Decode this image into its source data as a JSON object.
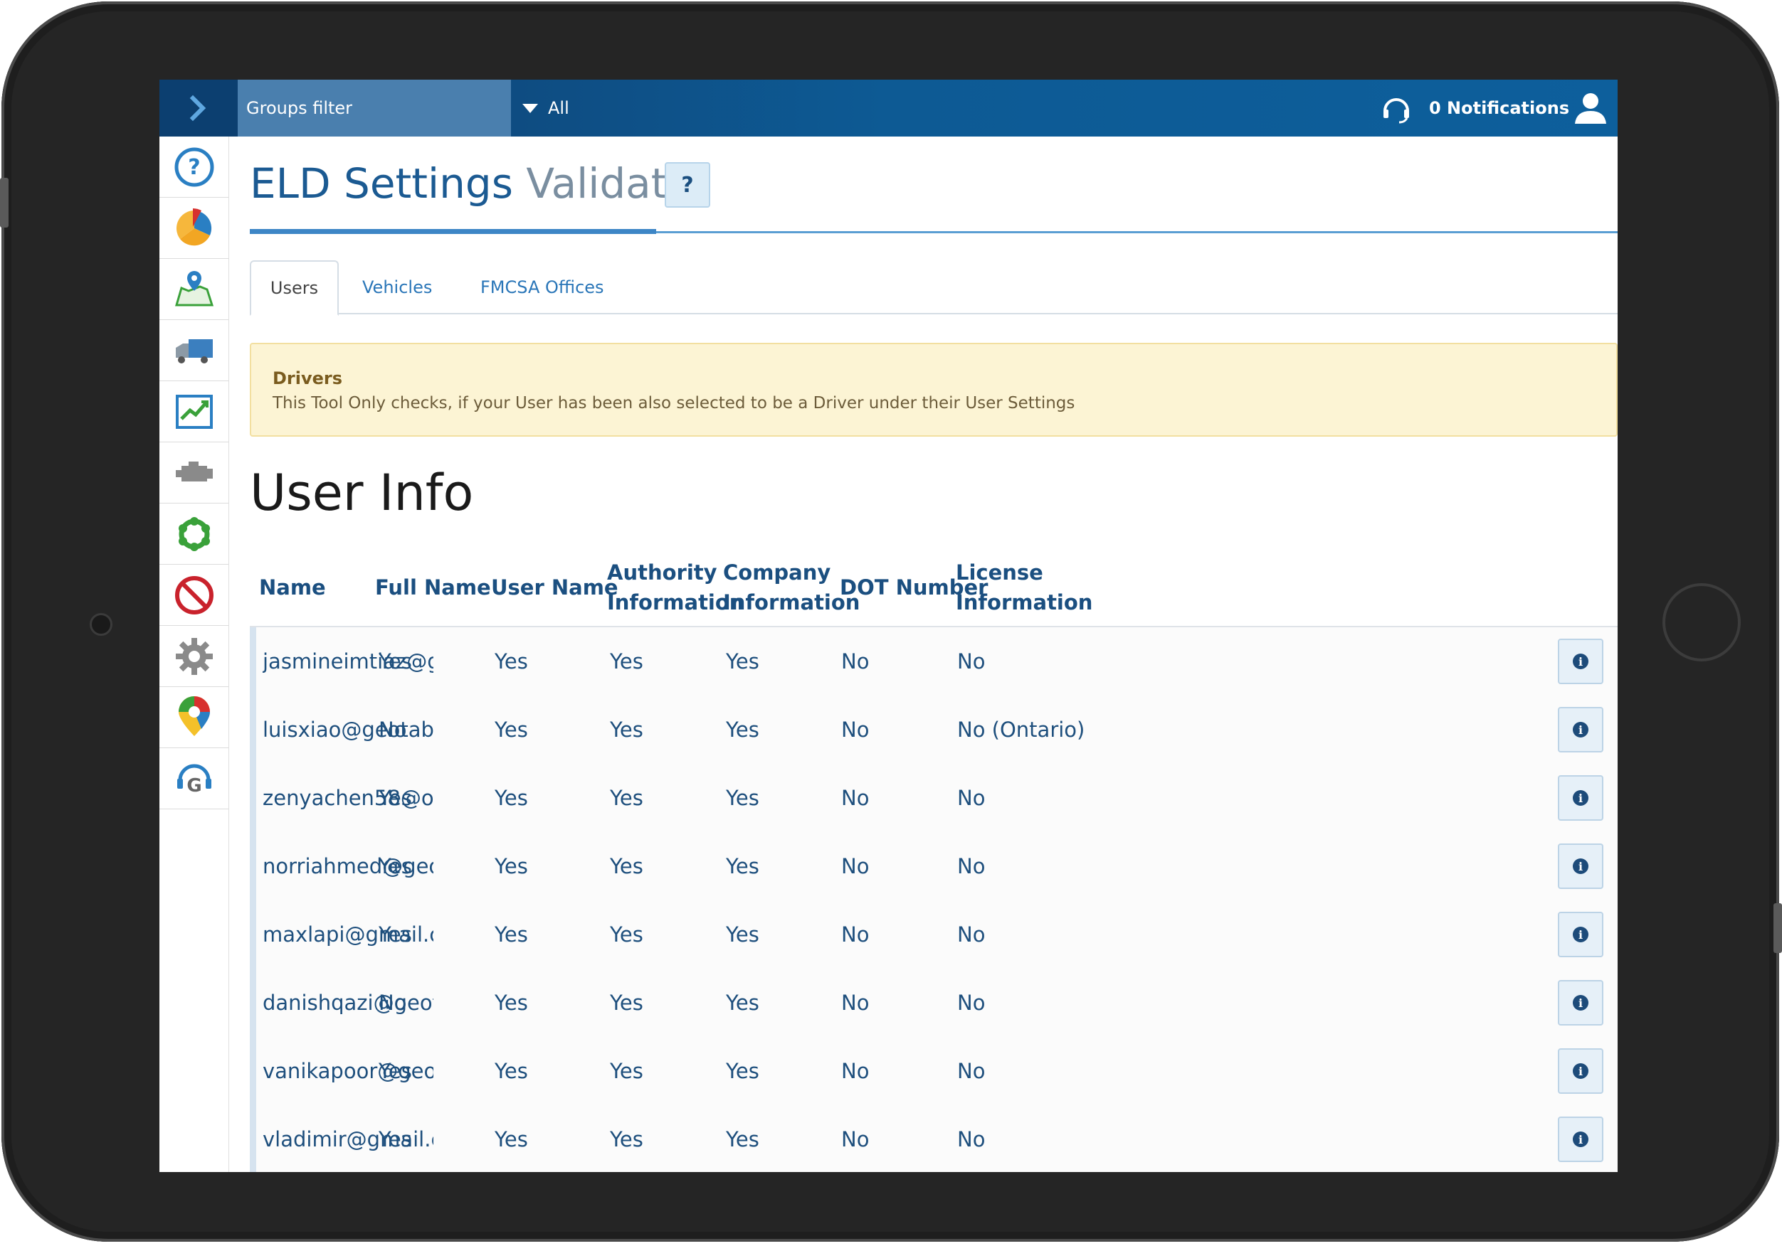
{
  "topbar": {
    "groups_filter": "Groups filter",
    "groups_value": "All",
    "notifications": "0 Notifications"
  },
  "sidebar": {
    "items": [
      {
        "icon": "help-icon"
      },
      {
        "icon": "dashboard-pie-icon"
      },
      {
        "icon": "map-icon"
      },
      {
        "icon": "vehicles-truck-icon"
      },
      {
        "icon": "activity-report-icon"
      },
      {
        "icon": "engine-icon"
      },
      {
        "icon": "rules-icon"
      },
      {
        "icon": "exceptions-icon"
      },
      {
        "icon": "settings-gear-icon"
      },
      {
        "icon": "marketplace-icon"
      },
      {
        "icon": "support-icon"
      }
    ]
  },
  "page": {
    "title_main": "ELD Settings",
    "title_light": "Validator",
    "help_label": "?"
  },
  "tabs": [
    {
      "label": "Users",
      "active": true
    },
    {
      "label": "Vehicles",
      "active": false
    },
    {
      "label": "FMCSA Offices",
      "active": false
    }
  ],
  "alert": {
    "heading": "Drivers",
    "text": "This Tool Only checks, if your User has been also selected to be a Driver under their User Settings"
  },
  "section_title": "User Info",
  "table": {
    "headers": [
      "Name",
      "Full Name",
      "User Name",
      "Authority Information",
      "Company Information",
      "DOT Number",
      "License Information"
    ],
    "header_lines": [
      [
        "Name"
      ],
      [
        "Full Name"
      ],
      [
        "User Name"
      ],
      [
        "Authority",
        "Information"
      ],
      [
        "Company",
        "Information"
      ],
      [
        "DOT Number"
      ],
      [
        "License",
        "Information"
      ]
    ],
    "rows": [
      [
        "jasmineimtiaz@ge",
        "Yes",
        "Yes",
        "Yes",
        "Yes",
        "No",
        "No"
      ],
      [
        "luisxiao@geotab.c",
        "No",
        "Yes",
        "Yes",
        "Yes",
        "No",
        "No (Ontario)"
      ],
      [
        "zenyachen58@ou",
        "Yes",
        "Yes",
        "Yes",
        "Yes",
        "No",
        "No"
      ],
      [
        "norriahmed@geot",
        "Yes",
        "Yes",
        "Yes",
        "Yes",
        "No",
        "No"
      ],
      [
        "maxlapi@gmail.cc",
        "Yes",
        "Yes",
        "Yes",
        "Yes",
        "No",
        "No"
      ],
      [
        "danishqazi@geota",
        "No",
        "Yes",
        "Yes",
        "Yes",
        "No",
        "No"
      ],
      [
        "vanikapoor@geot",
        "Yes",
        "Yes",
        "Yes",
        "Yes",
        "No",
        "No"
      ],
      [
        "vladimir@gmail.cc",
        "Yes",
        "Yes",
        "Yes",
        "Yes",
        "No",
        "No"
      ]
    ],
    "info_label": "i"
  },
  "colors": {
    "topbar": "#0d5a94",
    "accent": "#1b5a92",
    "alert_bg": "#fcf4d4"
  }
}
